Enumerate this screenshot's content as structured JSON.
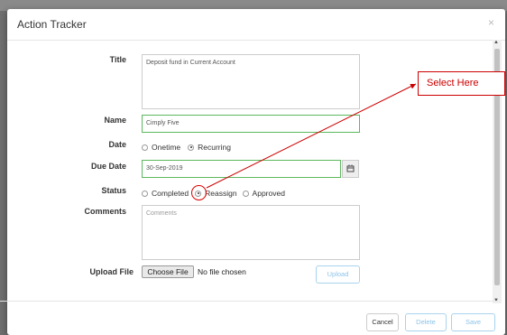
{
  "modal": {
    "title": "Action Tracker",
    "close": "×"
  },
  "labels": {
    "title": "Title",
    "name": "Name",
    "date": "Date",
    "due_date": "Due Date",
    "status": "Status",
    "comments": "Comments",
    "upload_file": "Upload File"
  },
  "fields": {
    "title_value": "Deposit fund in Current Account",
    "name_value": "Cimply Five",
    "due_date_value": "30-Sep-2019",
    "comments_placeholder": "Comments"
  },
  "date_options": [
    {
      "label": "Onetime",
      "checked": false
    },
    {
      "label": "Recurring",
      "checked": true
    }
  ],
  "status_options": [
    {
      "label": "Completed",
      "checked": false
    },
    {
      "label": "Reassign",
      "checked": true
    },
    {
      "label": "Approved",
      "checked": false
    }
  ],
  "upload": {
    "choose_file": "Choose File",
    "no_file": "No file chosen",
    "upload_button": "Upload"
  },
  "footer": {
    "cancel": "Cancel",
    "delete": "Delete",
    "save": "Save"
  },
  "annotation": {
    "callout": "Select Here",
    "color": "#cc0000"
  },
  "icons": {
    "calendar": "calendar-icon",
    "close": "close-icon"
  }
}
